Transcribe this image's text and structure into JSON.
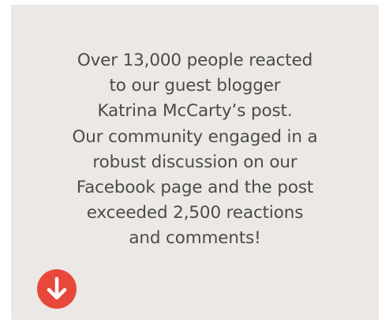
{
  "card": {
    "background": "#ebe8e5",
    "text_color": "#4b4b4b",
    "lines": [
      "Over 13,000 people reacted",
      "to our guest blogger",
      "Katrina McCarty’s post.",
      "Our community engaged in a",
      "robust discussion on our",
      "Facebook page and the post",
      "exceeded 2,500 reactions",
      "and comments!"
    ]
  },
  "scroll_button": {
    "icon": "arrow-down-icon",
    "color": "#e8483a"
  }
}
